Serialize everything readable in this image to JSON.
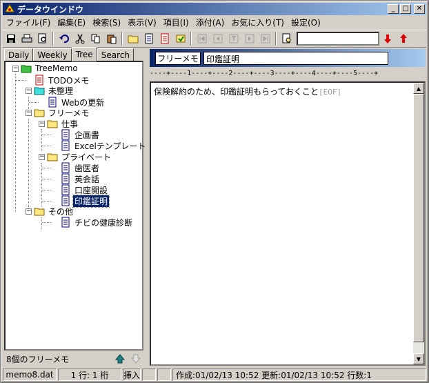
{
  "window": {
    "title": "データウインドウ"
  },
  "menu": [
    "ファイル(F)",
    "編集(E)",
    "検索(S)",
    "表示(V)",
    "項目(I)",
    "添付(A)",
    "お気に入り(T)",
    "設定(O)"
  ],
  "toolbar": {
    "search_value": ""
  },
  "tabs": [
    "Daily",
    "Weekly",
    "Tree",
    "Search"
  ],
  "active_tab": "Tree",
  "tree": {
    "root": "TreeMemo",
    "todo": "TODOメモ",
    "unsorted": "未整理",
    "web_update": "Webの更新",
    "free": "フリーメモ",
    "work": "仕事",
    "planning": "企画書",
    "excel": "Excelテンプレート",
    "private": "プライベート",
    "dentist": "歯医者",
    "english": "英会話",
    "account": "口座開設",
    "seal": "印鑑証明",
    "other": "その他",
    "checkup": "チビの健康診断"
  },
  "left_footer": {
    "label": "8個のフリーメモ"
  },
  "memo": {
    "category": "フリーメモ",
    "title": "印鑑証明",
    "ruler": "----+----1----+----2----+----3----+----4----+----5----+",
    "body": "保険解約のため、印鑑証明もらっておくこと",
    "eof": "[EOF]"
  },
  "status": {
    "file": "memo8.dat",
    "position": "1 行:  1 桁",
    "mode": "挿入",
    "info": "作成:01/02/13 10:52  更新:01/02/13 10:52  行数:1"
  },
  "colors": {
    "accent": "#0a246a",
    "face": "#d4d0c8"
  }
}
